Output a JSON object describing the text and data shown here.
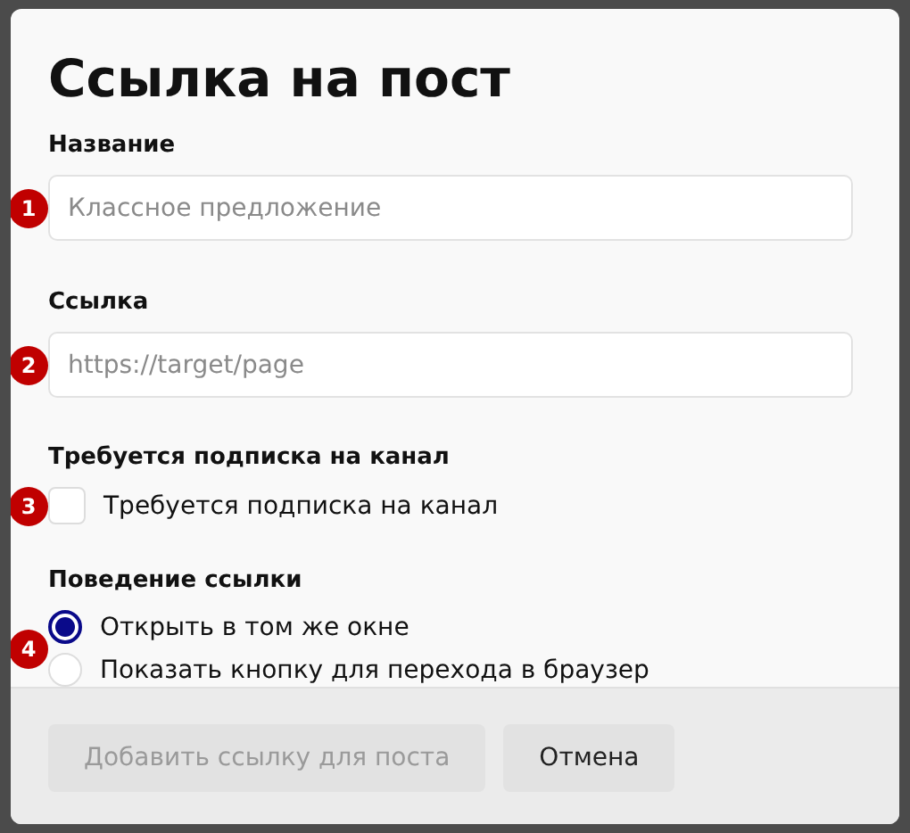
{
  "dialog": {
    "title": "Ссылка на пост"
  },
  "fields": [
    {
      "label": "Название",
      "placeholder": "Классное предложение",
      "badge": "1"
    },
    {
      "label": "Ссылка",
      "placeholder": "https://target/page",
      "badge": "2"
    }
  ],
  "subscription": {
    "label": "Требуется подписка на канал",
    "checkbox_label": "Требуется подписка на канал",
    "checked": false,
    "badge": "3"
  },
  "link_behavior": {
    "label": "Поведение ссылки",
    "badge": "4",
    "options": [
      {
        "label": "Открыть в том же окне",
        "selected": true
      },
      {
        "label": "Показать кнопку для перехода в браузер",
        "selected": false
      }
    ]
  },
  "buttons": [
    {
      "label": "Добавить ссылку для поста",
      "disabled": true
    },
    {
      "label": "Отмена",
      "disabled": false
    }
  ]
}
